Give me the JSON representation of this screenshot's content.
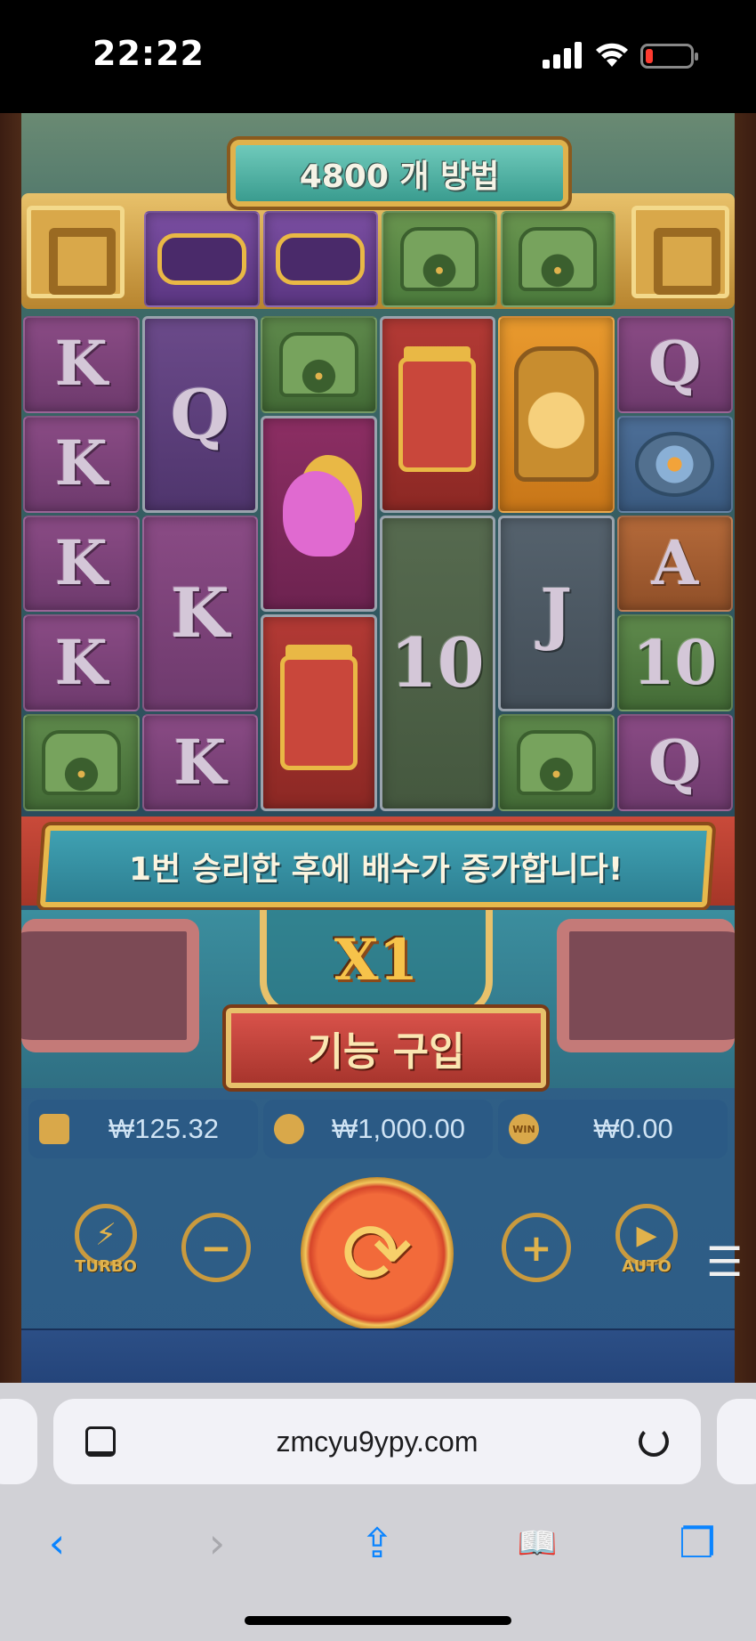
{
  "status_bar": {
    "time": "22:22",
    "battery_color": "#ff3b30"
  },
  "game": {
    "ways_label": "4800 개 방법",
    "top_row": [
      {
        "icon": "purple-serpent-icon",
        "bg": "top-purple"
      },
      {
        "icon": "purple-serpent-icon",
        "bg": "top-purple"
      },
      {
        "icon": "green-mask-icon",
        "bg": "top-green"
      },
      {
        "icon": "green-mask-icon",
        "bg": "top-green"
      }
    ],
    "reels": [
      [
        {
          "t": "K",
          "bg": "purple"
        },
        {
          "t": "K",
          "bg": "purple"
        },
        {
          "t": "K",
          "bg": "purple"
        },
        {
          "t": "K",
          "bg": "purple"
        },
        {
          "icon": "green-mask-icon",
          "bg": "green"
        }
      ],
      [
        {
          "t": "Q",
          "bg": "violet",
          "span": 2
        },
        {
          "t": "K",
          "bg": "purple",
          "span": 2
        },
        {
          "t": "K",
          "bg": "purple"
        }
      ],
      [
        {
          "icon": "green-mask-icon",
          "bg": "green"
        },
        {
          "icon": "pink-bird-icon",
          "bg": "magenta",
          "span": 2
        },
        {
          "icon": "red-mask-icon",
          "bg": "red",
          "span": 2
        }
      ],
      [
        {
          "icon": "red-mask-icon",
          "bg": "red",
          "span": 2
        },
        {
          "t": "10",
          "bg": "olive",
          "span": 3
        }
      ],
      [
        {
          "icon": "gold-mask-icon",
          "bg": "orange",
          "span": 2
        },
        {
          "t": "J",
          "bg": "slate",
          "span": 2
        },
        {
          "icon": "green-mask-icon",
          "bg": "green"
        }
      ],
      [
        {
          "t": "Q",
          "bg": "purple"
        },
        {
          "icon": "blue-wheel-icon",
          "bg": "blue"
        },
        {
          "t": "A",
          "bg": "brown"
        },
        {
          "t": "10",
          "bg": "green"
        },
        {
          "t": "Q",
          "bg": "purple"
        }
      ]
    ],
    "message": "1번 승리한 후에 배수가 증가합니다!",
    "multiplier": "X1",
    "buy_feature_label": "기능 구입",
    "balance": "₩125.32",
    "bet": "₩1,000.00",
    "win": "₩0.00",
    "win_icon_label": "WIN",
    "turbo_label": "TURBO",
    "auto_label": "AUTO",
    "minus_glyph": "−",
    "plus_glyph": "+",
    "spin_glyph": "⟳",
    "menu_glyph": "☰"
  },
  "browser": {
    "url": "zmcyu9ypy.com",
    "toolbar": {
      "back": "‹",
      "forward": "›",
      "share": "⇪",
      "bookmarks": "📖",
      "tabs": "❐"
    },
    "accent": "#0a84ff"
  }
}
